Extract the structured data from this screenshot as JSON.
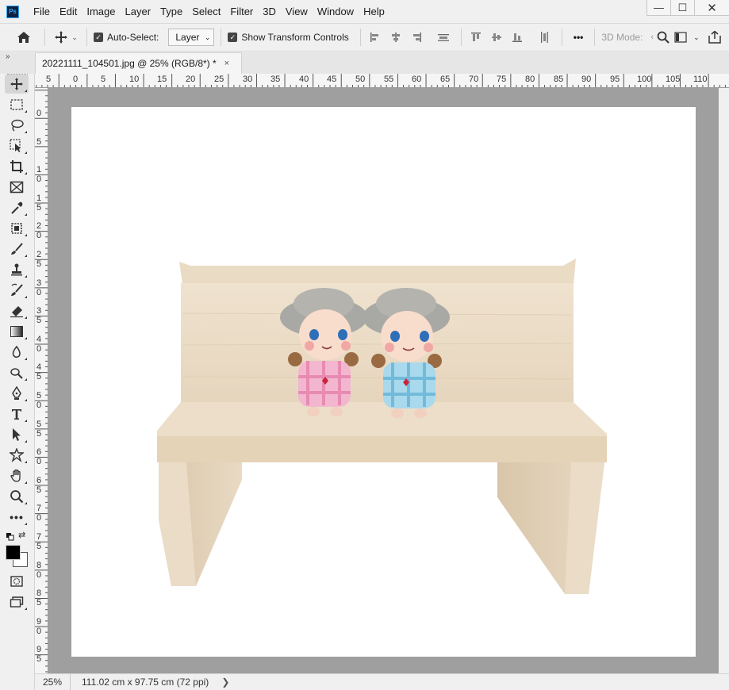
{
  "app": {
    "logo": "Ps"
  },
  "menu": [
    "File",
    "Edit",
    "Image",
    "Layer",
    "Type",
    "Select",
    "Filter",
    "3D",
    "View",
    "Window",
    "Help"
  ],
  "window_controls": {
    "minimize": "—",
    "maximize": "☐",
    "close": "✕"
  },
  "options": {
    "auto_select_label": "Auto-Select:",
    "auto_select_checked": true,
    "layer_dropdown": "Layer",
    "show_transform_label": "Show Transform Controls",
    "show_transform_checked": true,
    "more_label": "•••",
    "mode_3d_label": "3D Mode:"
  },
  "tab": {
    "title": "20221111_104501.jpg @ 25% (RGB/8*) *",
    "close": "×"
  },
  "toolbar": {
    "tools": [
      "move-tool",
      "marquee-tool",
      "lasso-tool",
      "object-selection-tool",
      "crop-tool",
      "frame-tool",
      "eyedropper-tool",
      "healing-brush-tool",
      "brush-tool",
      "clone-stamp-tool",
      "history-brush-tool",
      "eraser-tool",
      "gradient-tool",
      "blur-tool",
      "dodge-tool",
      "pen-tool",
      "type-tool",
      "path-selection-tool",
      "custom-shape-tool",
      "hand-tool",
      "zoom-tool",
      "edit-toolbar"
    ],
    "foreground_color": "#000000",
    "background_color": "#ffffff"
  },
  "ruler_top": [
    "5",
    "0",
    "5",
    "10",
    "15",
    "20",
    "25",
    "30",
    "35",
    "40",
    "45",
    "50",
    "55",
    "60",
    "65",
    "70",
    "75",
    "80",
    "85",
    "90",
    "95",
    "100",
    "105",
    "110"
  ],
  "ruler_left": [
    "0",
    "5",
    "10",
    "15",
    "20",
    "25",
    "30",
    "35",
    "40",
    "45",
    "50",
    "55",
    "60",
    "65",
    "70",
    "75",
    "80",
    "85",
    "90",
    "95"
  ],
  "status": {
    "zoom": "25%",
    "doc_size": "111.02 cm x 97.75 cm (72 ppi)",
    "arrow": "❯"
  },
  "colors": {
    "canvas_bg": "#9f9f9f",
    "ui_bg": "#f0f0f0",
    "accent": "#31a8ff"
  }
}
